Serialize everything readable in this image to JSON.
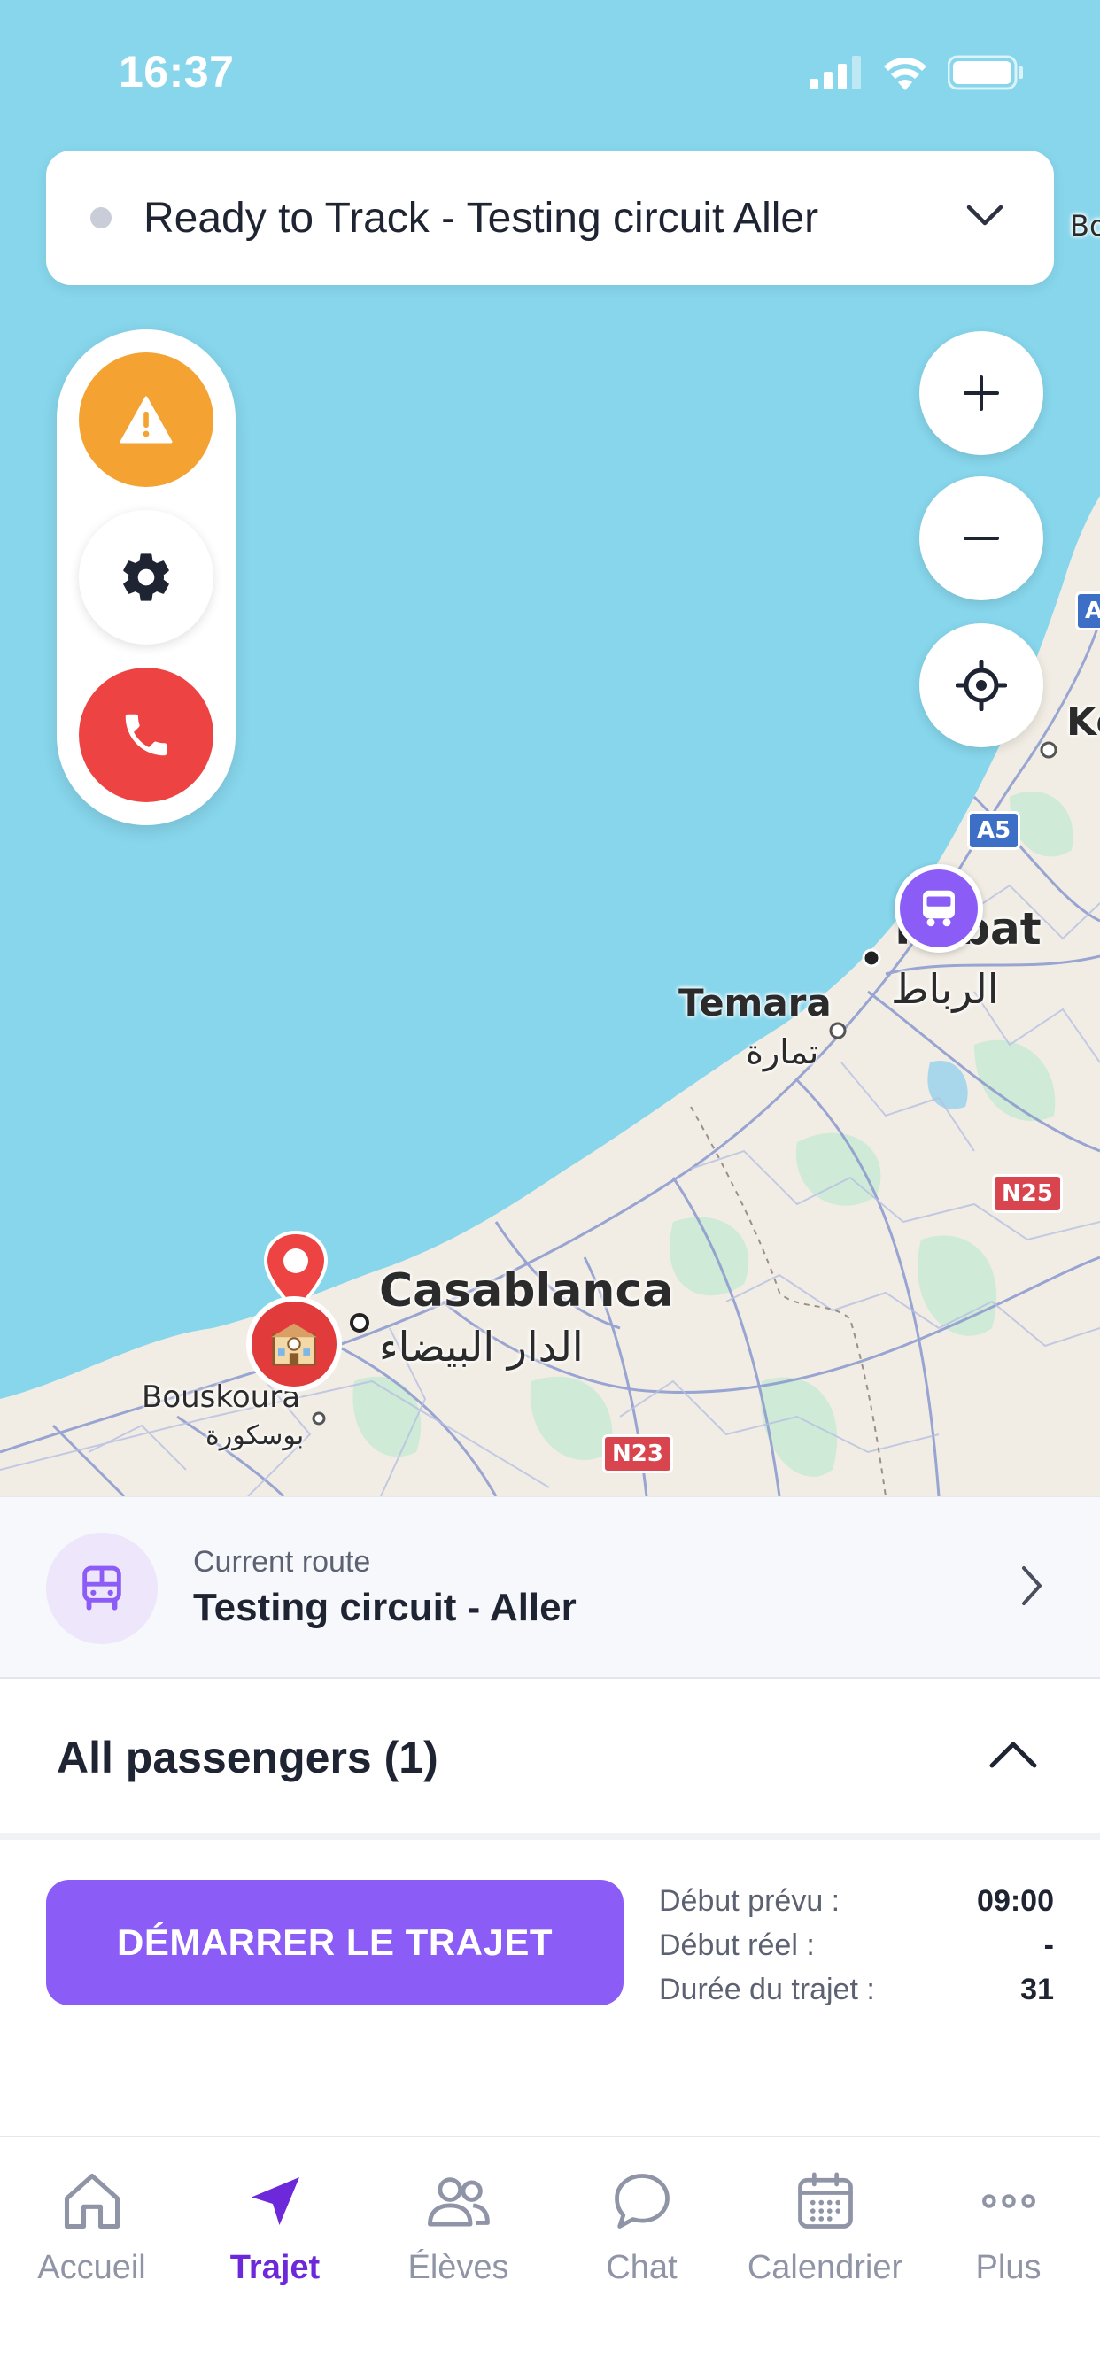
{
  "status_bar": {
    "time": "16:37"
  },
  "trip_selector": {
    "title": "Ready to Track - Testing circuit Aller"
  },
  "map": {
    "labels": {
      "casablanca": "Casablanca",
      "casablanca_ar": "الدار البيضاء",
      "temara": "Temara",
      "temara_ar": "تمارة",
      "rabat": "Rabat",
      "rabat_ar": "الرباط",
      "bouskoura": "Bouskoura",
      "bouskoura_ar": "بوسكورة",
      "kenitra_partial": "Ke",
      "bo_partial": "Bo"
    },
    "shields": {
      "a5": "A5",
      "a_partial": "A",
      "n25": "N25",
      "n23": "N23"
    }
  },
  "current_route": {
    "caption": "Current route",
    "name": "Testing circuit - Aller"
  },
  "passengers": {
    "title": "All passengers (1)"
  },
  "trip_panel": {
    "start_button": "DÉMARRER LE TRAJET",
    "rows": [
      {
        "label": "Début prévu :",
        "value": "09:00"
      },
      {
        "label": "Début réel :",
        "value": "-"
      },
      {
        "label": "Durée du trajet :",
        "value": "31"
      }
    ]
  },
  "tabbar": {
    "items": [
      {
        "label": "Accueil",
        "icon": "home-icon"
      },
      {
        "label": "Trajet",
        "icon": "navigation-arrow-icon",
        "active": true
      },
      {
        "label": "Élèves",
        "icon": "users-icon"
      },
      {
        "label": "Chat",
        "icon": "chat-bubble-icon"
      },
      {
        "label": "Calendrier",
        "icon": "calendar-icon"
      },
      {
        "label": "Plus",
        "icon": "more-dots-icon"
      }
    ]
  },
  "colors": {
    "accent": "#8b5cf6",
    "active_tab": "#6d28d9",
    "alert": "#f4a232",
    "danger": "#ee4343",
    "sea": "#87d6ec"
  }
}
